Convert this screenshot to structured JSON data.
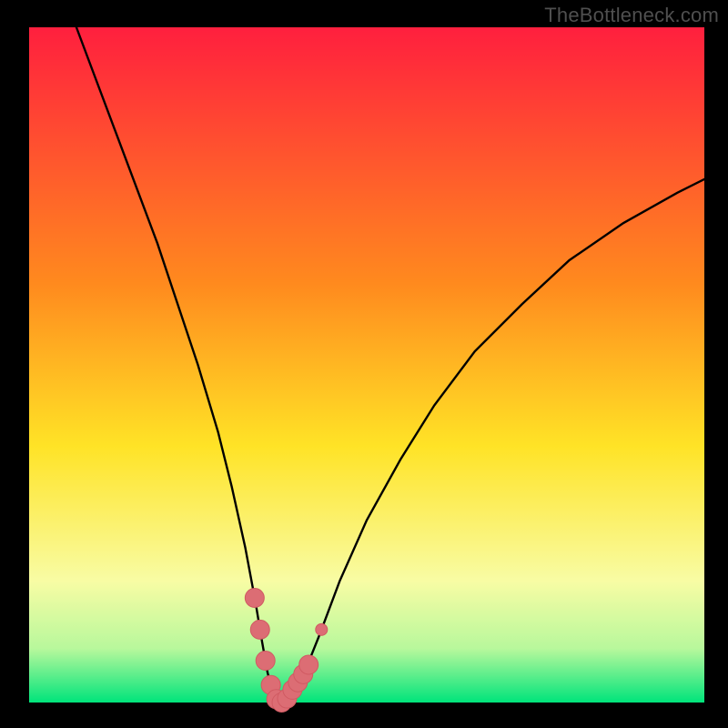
{
  "watermark": "TheBottleneck.com",
  "colors": {
    "background": "#000000",
    "gradient_top": "#ff1f3e",
    "gradient_mid1": "#ff8a1e",
    "gradient_mid2": "#ffe326",
    "gradient_mid3": "#f8fca4",
    "gradient_bot1": "#b8f89c",
    "gradient_bot2": "#00e47b",
    "curve": "#000000",
    "markers_fill": "#dc6d74",
    "markers_stroke": "#d05a62",
    "watermark": "#4f4f4f"
  },
  "chart_data": {
    "type": "line",
    "title": "",
    "xlabel": "",
    "ylabel": "",
    "xlim": [
      0,
      100
    ],
    "ylim": [
      0,
      100
    ],
    "grid": false,
    "legend": false,
    "series": [
      {
        "name": "bottleneck-curve",
        "x": [
          7,
          10,
          13,
          16,
          19,
          22,
          25,
          28,
          30,
          32,
          33.5,
          34.5,
          35.3,
          36,
          36.5,
          37,
          37.5,
          38.5,
          39.5,
          41,
          43,
          46,
          50,
          55,
          60,
          66,
          73,
          80,
          88,
          96,
          100
        ],
        "y": [
          100,
          92,
          84,
          76,
          68,
          59,
          50,
          40,
          32,
          23,
          15,
          9,
          4.5,
          1.6,
          0.4,
          0,
          0.3,
          0.9,
          2,
          5,
          10,
          18,
          27,
          36,
          44,
          52,
          59,
          65.5,
          71,
          75.5,
          77.5
        ]
      }
    ],
    "markers": {
      "name": "highlighted-range",
      "x": [
        33.4,
        34.2,
        35.0,
        35.8,
        36.6,
        37.4,
        38.2,
        39.0,
        39.8,
        40.6,
        41.4,
        43.3
      ],
      "y": [
        15.5,
        10.8,
        6.2,
        2.6,
        0.5,
        0.0,
        0.6,
        1.9,
        3.0,
        4.2,
        5.6,
        10.8
      ]
    },
    "background_gradient": {
      "orientation": "vertical",
      "stops": [
        {
          "offset": 0.0,
          "color": "#ff1f3e"
        },
        {
          "offset": 0.38,
          "color": "#ff8a1e"
        },
        {
          "offset": 0.62,
          "color": "#ffe326"
        },
        {
          "offset": 0.82,
          "color": "#f8fca4"
        },
        {
          "offset": 0.92,
          "color": "#b8f89c"
        },
        {
          "offset": 1.0,
          "color": "#00e47b"
        }
      ]
    }
  }
}
